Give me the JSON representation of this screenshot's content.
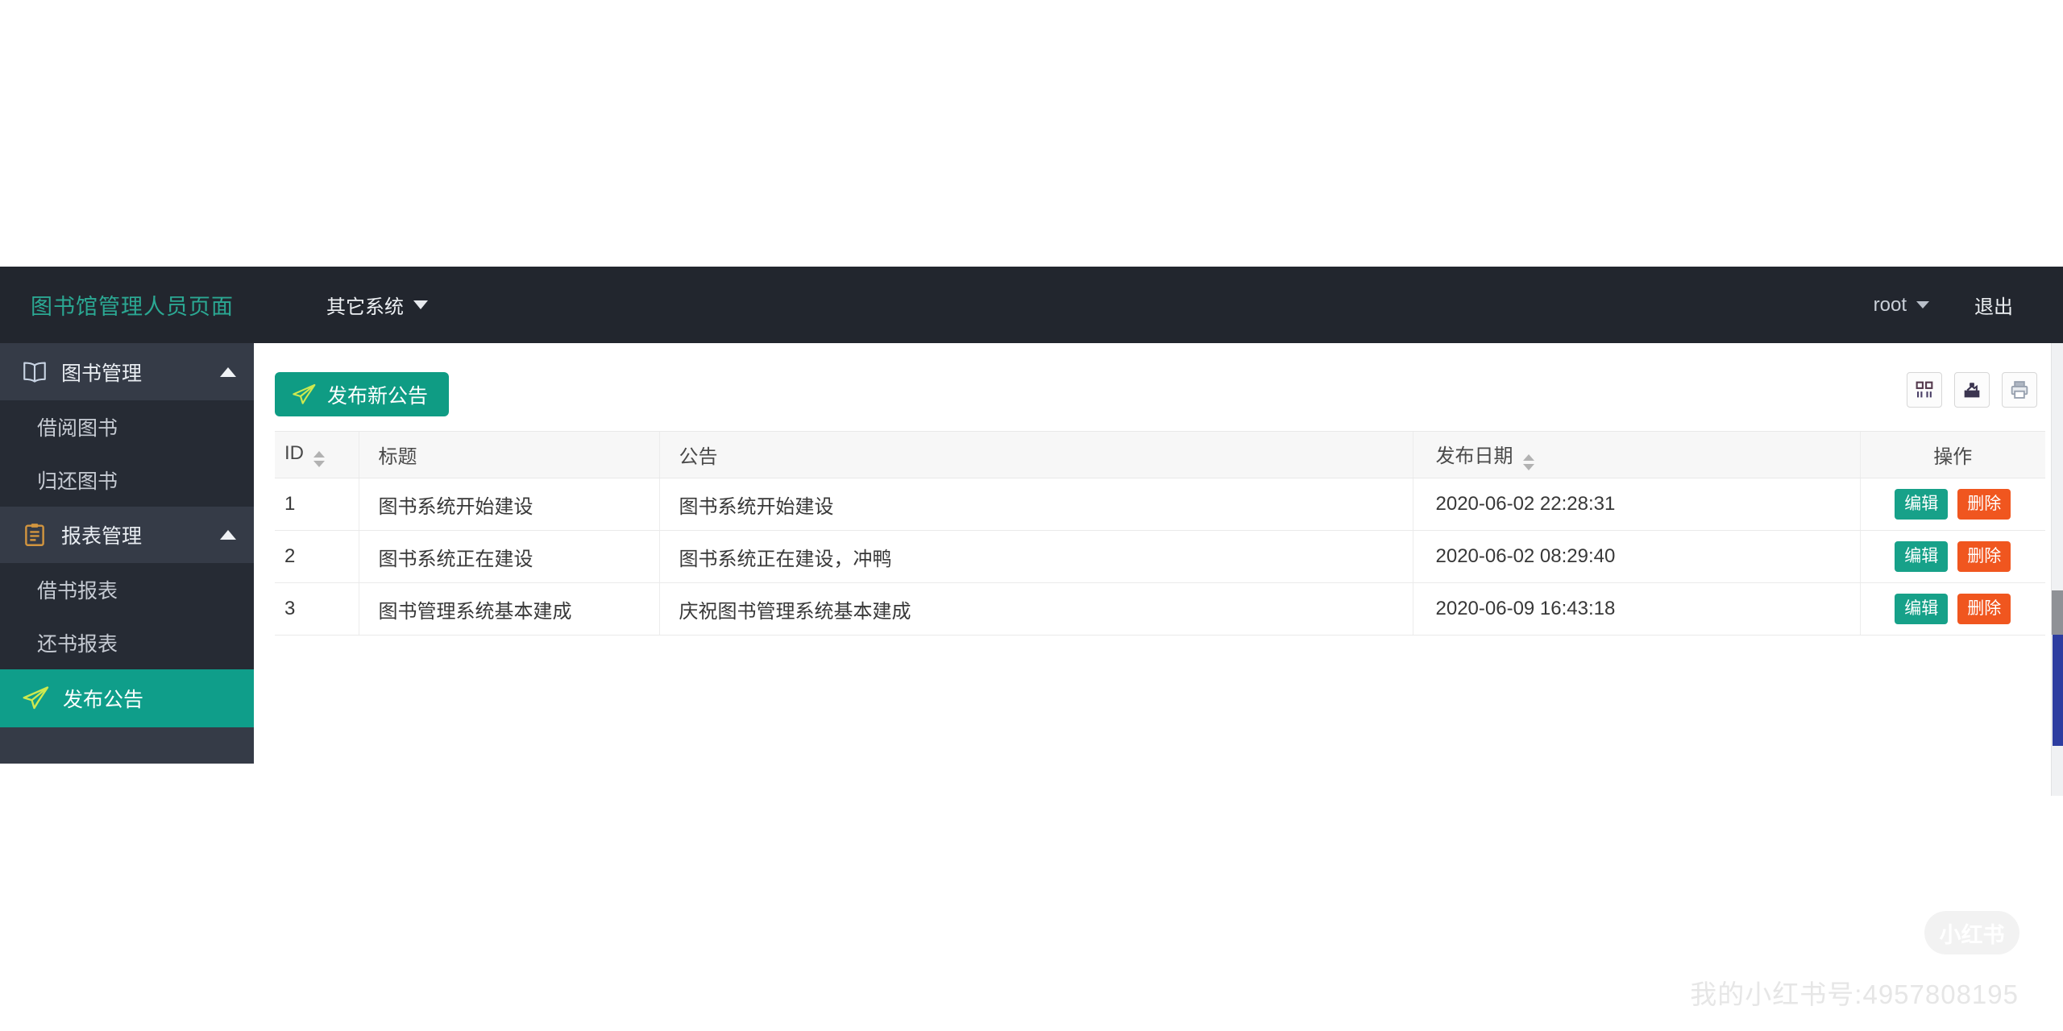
{
  "app": {
    "title": "图书馆管理人员页面"
  },
  "header": {
    "menu_other_systems": "其它系统",
    "username": "root",
    "logout_label": "退出"
  },
  "sidebar": {
    "groups": [
      {
        "label": "图书管理",
        "icon": "book-icon",
        "items": [
          {
            "label": "借阅图书"
          },
          {
            "label": "归还图书"
          }
        ]
      },
      {
        "label": "报表管理",
        "icon": "clipboard-icon",
        "items": [
          {
            "label": "借书报表"
          },
          {
            "label": "还书报表"
          }
        ]
      }
    ],
    "active": {
      "label": "发布公告",
      "icon": "paper-plane-icon"
    }
  },
  "toolbar": {
    "publish_button": "发布新公告",
    "icon_buttons": [
      "columns-icon",
      "export-icon",
      "print-icon"
    ]
  },
  "announcements": {
    "columns": [
      {
        "label": "ID",
        "sortable": true
      },
      {
        "label": "标题",
        "sortable": false
      },
      {
        "label": "公告",
        "sortable": false
      },
      {
        "label": "发布日期",
        "sortable": true
      },
      {
        "label": "操作",
        "sortable": false
      }
    ],
    "actions": {
      "edit": "编辑",
      "delete": "删除"
    },
    "rows": [
      {
        "id": "1",
        "title": "图书系统开始建设",
        "content": "图书系统开始建设",
        "date": "2020-06-02 22:28:31"
      },
      {
        "id": "2",
        "title": "图书系统正在建设",
        "content": "图书系统正在建设，冲鸭",
        "date": "2020-06-02 08:29:40"
      },
      {
        "id": "3",
        "title": "图书管理系统基本建成",
        "content": "庆祝图书管理系统基本建成",
        "date": "2020-06-09 16:43:18"
      }
    ]
  },
  "watermark": {
    "badge": "小红书",
    "text": "我的小红书号:4957808195"
  },
  "colors": {
    "accent_teal": "#0f9c84",
    "sidebar_active": "#0f9e8a",
    "danger_orange": "#f0561f",
    "header_bg": "#22262e",
    "sidebar_bg": "#262b34",
    "sidebar_group_bg": "#353b47",
    "brand_text": "#2ba893",
    "scroll_blue": "#2d3da0"
  }
}
